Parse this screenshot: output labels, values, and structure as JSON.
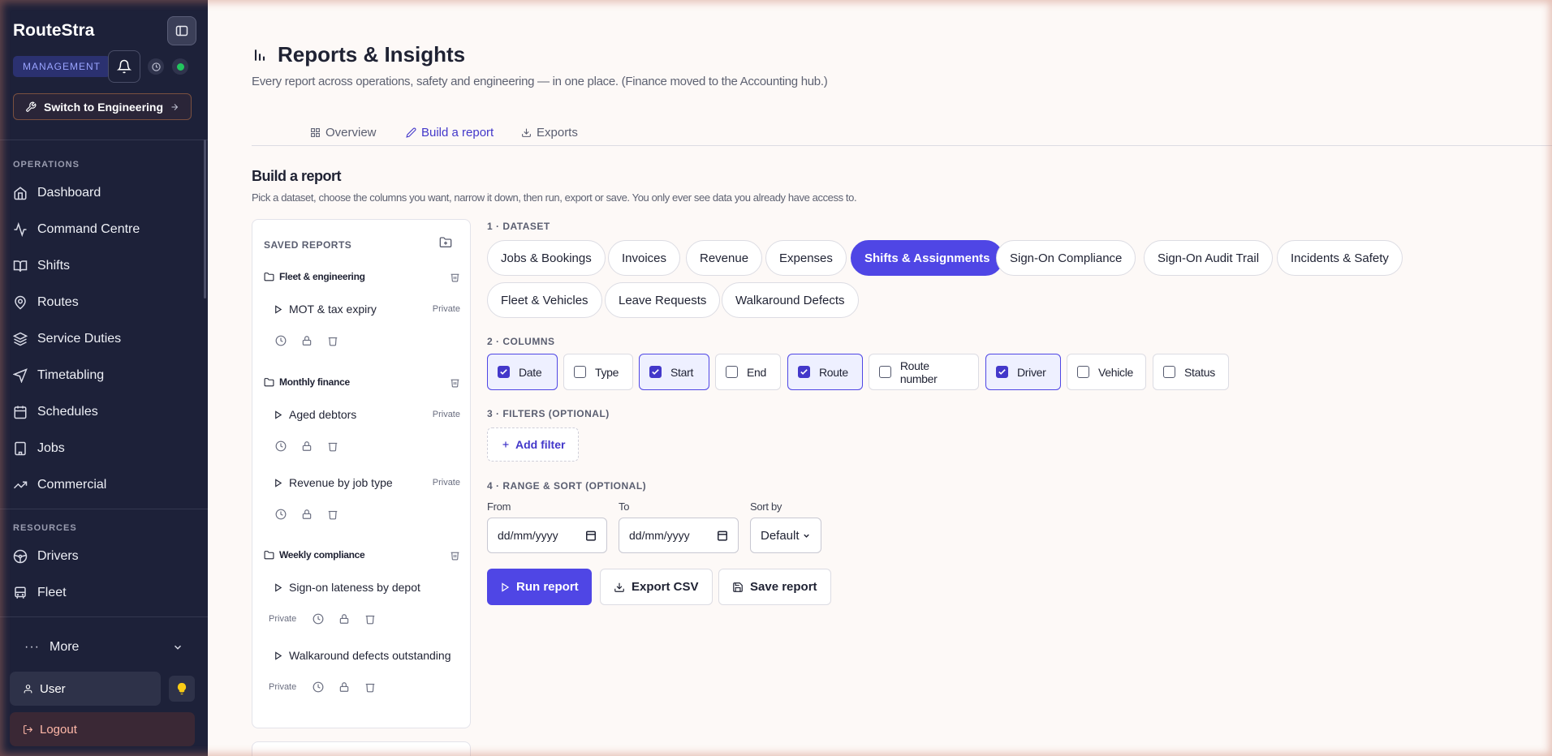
{
  "sidebar": {
    "brand": "RouteStra",
    "role_badge": "MANAGEMENT",
    "switch_label": "Switch to Engineering",
    "operations_label": "OPERATIONS",
    "operations_items": [
      "Dashboard",
      "Command Centre",
      "Shifts",
      "Routes",
      "Service Duties",
      "Timetabling",
      "Schedules",
      "Jobs",
      "Commercial"
    ],
    "resources_label": "RESOURCES",
    "resources_items": [
      "Drivers",
      "Fleet"
    ],
    "more_label": "More",
    "user_label": "User",
    "logout_label": "Logout",
    "status_color": "#22c55e"
  },
  "header": {
    "title": "Reports & Insights",
    "subtitle": "Every report across operations, safety and engineering — in one place. (Finance moved to the Accounting hub.)"
  },
  "tabs": [
    {
      "label": "Overview",
      "icon": "grid-icon",
      "active": false
    },
    {
      "label": "Build a report",
      "icon": "pencil-icon",
      "active": true
    },
    {
      "label": "Exports",
      "icon": "download-icon",
      "active": false
    }
  ],
  "builder": {
    "title": "Build a report",
    "subtitle": "Pick a dataset, choose the columns you want, narrow it down, then run, export or save. You only ever see data you already have access to.",
    "step1": "1 · DATASET",
    "step2": "2 · COLUMNS",
    "step3": "3 · FILTERS (OPTIONAL)",
    "step4": "4 · RANGE & SORT (OPTIONAL)",
    "datasets_row1": [
      "Jobs & Bookings",
      "Invoices",
      "Revenue",
      "Expenses",
      "Shifts & Assignments",
      "Sign-On Compliance",
      "Sign-On Audit Trail",
      "Incidents & Safety"
    ],
    "datasets_row2": [
      "Fleet & Vehicles",
      "Leave Requests",
      "Walkaround Defects"
    ],
    "selected_dataset": "Shifts & Assignments",
    "columns": [
      {
        "label": "Date",
        "checked": true
      },
      {
        "label": "Type",
        "checked": false
      },
      {
        "label": "Start",
        "checked": true
      },
      {
        "label": "End",
        "checked": false
      },
      {
        "label": "Route",
        "checked": true
      },
      {
        "label": "Route number",
        "checked": false
      },
      {
        "label": "Driver",
        "checked": true
      },
      {
        "label": "Vehicle",
        "checked": false
      },
      {
        "label": "Status",
        "checked": false
      }
    ],
    "add_filter": "Add filter",
    "from_label": "From",
    "from_value": "dd/mm/yyyy",
    "to_label": "To",
    "to_value": "dd/mm/yyyy",
    "sort_label": "Sort by",
    "sort_value": "Default",
    "run_label": "Run report",
    "export_label": "Export CSV",
    "save_label": "Save report",
    "accent": "#4f46e5"
  },
  "saved": {
    "title": "SAVED REPORTS",
    "private_label": "Private",
    "folders": [
      {
        "name": "Fleet & engineering",
        "reports": [
          "MOT & tax expiry"
        ]
      },
      {
        "name": "Monthly finance",
        "reports": [
          "Aged debtors",
          "Revenue by job type"
        ]
      },
      {
        "name": "Weekly compliance",
        "reports": [
          "Sign-on lateness by depot",
          "Walkaround defects outstanding"
        ]
      }
    ]
  }
}
